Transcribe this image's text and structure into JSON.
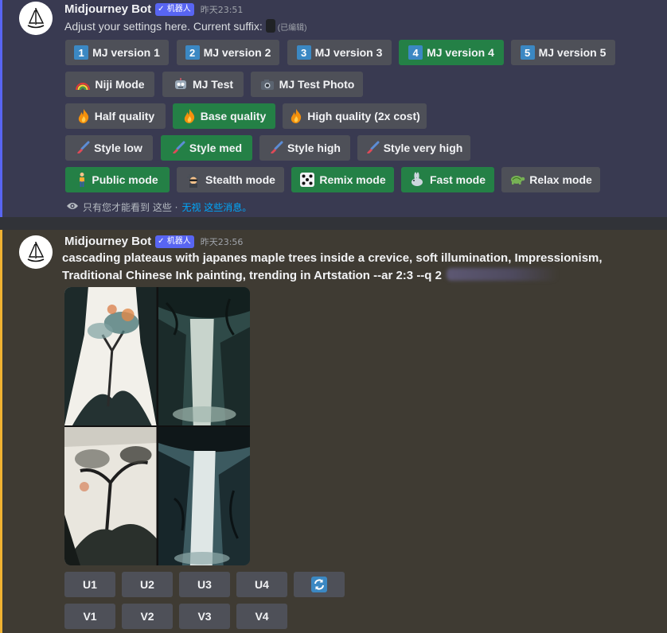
{
  "message1": {
    "username": "Midjourney Bot",
    "badge": "✓ 机器人",
    "timestamp": "昨天23:51",
    "text": "Adjust your settings here. Current suffix:",
    "edited": "(已编辑)",
    "rows": [
      [
        {
          "icon": "1",
          "label": "MJ version 1",
          "active": false
        },
        {
          "icon": "2",
          "label": "MJ version 2",
          "active": false
        },
        {
          "icon": "3",
          "label": "MJ version 3",
          "active": false
        },
        {
          "icon": "4",
          "label": "MJ version 4",
          "active": true
        },
        {
          "icon": "5",
          "label": "MJ version 5",
          "active": false
        }
      ],
      [
        {
          "icon": "rainbow-icon",
          "label": "Niji Mode",
          "active": false
        },
        {
          "icon": "robot-icon",
          "label": "MJ Test",
          "active": false
        },
        {
          "icon": "camera-icon",
          "label": "MJ Test Photo",
          "active": false
        }
      ],
      [
        {
          "icon": "fire-icon",
          "label": "Half quality",
          "active": false
        },
        {
          "icon": "fire-icon",
          "label": "Base quality",
          "active": true
        },
        {
          "icon": "fire-icon",
          "label": "High quality (2x cost)",
          "active": false
        }
      ],
      [
        {
          "icon": "brush-icon",
          "label": "Style low",
          "active": false
        },
        {
          "icon": "brush-icon",
          "label": "Style med",
          "active": true
        },
        {
          "icon": "brush-icon",
          "label": "Style high",
          "active": false
        },
        {
          "icon": "brush-icon",
          "label": "Style very high",
          "active": false
        }
      ],
      [
        {
          "icon": "person-icon",
          "label": "Public mode",
          "active": true
        },
        {
          "icon": "spy-icon",
          "label": "Stealth mode",
          "active": false
        },
        {
          "icon": "dice-icon",
          "label": "Remix mode",
          "active": true
        },
        {
          "icon": "rabbit-icon",
          "label": "Fast mode",
          "active": true
        },
        {
          "icon": "turtle-icon",
          "label": "Relax mode",
          "active": false
        }
      ]
    ],
    "ephemeral": {
      "text": "只有您才能看到 这些 · ",
      "link": "无视 这些消息。"
    }
  },
  "message2": {
    "username": "Midjourney Bot",
    "badge": "✓ 机器人",
    "timestamp": "昨天23:56",
    "prompt": "cascading plateaus with japanes maple trees inside a crevice, soft illumination, Impressionism, Traditional Chinese Ink painting, trending in Artstation --ar 2:3 --q 2",
    "upscale_buttons": [
      "U1",
      "U2",
      "U3",
      "U4"
    ],
    "variation_buttons": [
      "V1",
      "V2",
      "V3",
      "V4"
    ],
    "reroll_icon": "refresh-icon"
  },
  "colors": {
    "blurple": "#5865f2",
    "green": "#248046",
    "secondary": "#4e5058",
    "mention_bar": "#f0b232"
  }
}
